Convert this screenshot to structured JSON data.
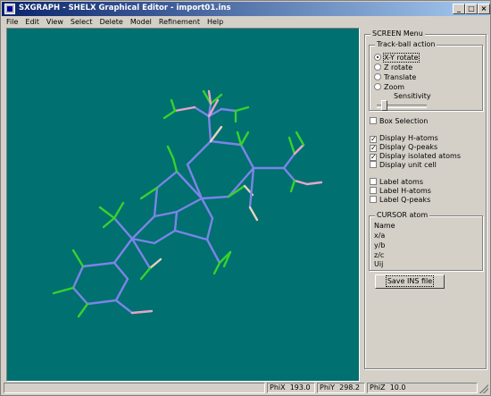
{
  "window": {
    "title": "SXGRAPH - SHELX Graphical Editor - import01.ins",
    "app_icon": "sxgraph-app-icon",
    "controls": {
      "minimize": "_",
      "maximize": "□",
      "close": "×"
    }
  },
  "menu": [
    "File",
    "Edit",
    "View",
    "Select",
    "Delete",
    "Model",
    "Refinement",
    "Help"
  ],
  "viewport": {
    "background": "#007070",
    "bond_color": "#7b84e8",
    "h_color": "#37d22d",
    "o_color": "#e8a6c8",
    "q_color": "#e8d0c0"
  },
  "panel": {
    "screen_menu_label": "SCREEN Menu",
    "trackball_label": "Track-ball action",
    "trackball_options": [
      "X-Y rotate",
      "Z rotate",
      "Translate",
      "Zoom"
    ],
    "trackball_selected": "X-Y rotate",
    "sensitivity_label": "Sensitivity",
    "sensitivity_level": 0.1,
    "box_selection": {
      "label": "Box Selection",
      "checked": false
    },
    "display_options": [
      {
        "label": "Display H-atoms",
        "checked": true
      },
      {
        "label": "Display Q-peaks",
        "checked": true
      },
      {
        "label": "Display isolated atoms",
        "checked": true
      },
      {
        "label": "Display unit cell",
        "checked": false
      }
    ],
    "label_options": [
      {
        "label": "Label atoms",
        "checked": false
      },
      {
        "label": "Label H-atoms",
        "checked": false
      },
      {
        "label": "Label Q-peaks",
        "checked": false
      }
    ],
    "cursor_atom_label": "CURSOR atom",
    "cursor_fields": [
      "Name",
      "x/a",
      "y/b",
      "z/c",
      "Uij"
    ],
    "save_button": "Save INS file"
  },
  "status": {
    "phix_label": "PhiX",
    "phix_value": "193.0",
    "phiy_label": "PhiY",
    "phiy_value": "298.2",
    "phiz_label": "PhiZ",
    "phiz_value": "10.0"
  }
}
